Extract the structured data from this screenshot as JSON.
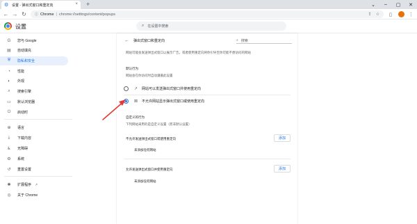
{
  "tab": {
    "title": "设置 - 弹出式窗口和重定向",
    "close": "×",
    "new_tab": "+"
  },
  "window_controls": [
    "⌄",
    "–",
    "▢",
    "✕"
  ],
  "toolbar": {
    "back": "←",
    "forward": "→",
    "reload": "↻",
    "omnibox_site": "Chrome",
    "omnibox_separator": "|",
    "omnibox_url": "chrome://settings/content/popups",
    "omnibox_icons": [
      "⇪",
      "☆"
    ]
  },
  "header": {
    "title": "设置",
    "search_placeholder": "在设置中搜索"
  },
  "sidebar": {
    "items": [
      {
        "label": "您与 Google",
        "icon": "G"
      },
      {
        "label": "自动填充",
        "icon": "▤"
      },
      {
        "label": "隐私和安全",
        "icon": "⛨",
        "active": true
      },
      {
        "label": "性能",
        "icon": "◔"
      },
      {
        "label": "外观",
        "icon": "◐"
      },
      {
        "label": "搜索引擎",
        "icon": "⌕"
      },
      {
        "label": "默认浏览器",
        "icon": "▭"
      },
      {
        "label": "启动时",
        "icon": "⏻"
      },
      {
        "label": "语言",
        "icon": "⊕"
      },
      {
        "label": "下载内容",
        "icon": "⤓"
      },
      {
        "label": "无障碍",
        "icon": "♿"
      },
      {
        "label": "系统",
        "icon": "⚙"
      },
      {
        "label": "重置设置",
        "icon": "↺"
      },
      {
        "label": "扩展程序",
        "icon": "✱"
      },
      {
        "label": "关于 Chrome",
        "icon": "◎"
      }
    ],
    "external_icon": "↗"
  },
  "card": {
    "back": "←",
    "title": "弹出式窗口和重定向",
    "search_placeholder": "搜索",
    "description": "网站可能会发送弹出式窗口以展示广告，或者使用重定向将你引导至你可能不想访问的网站",
    "default_title": "默认行为",
    "default_sub": "网站会在你访问时自动遵循此设置",
    "options": [
      {
        "label": "网站可以发送弹出式窗口并使用重定向",
        "icon": "↗",
        "checked": false
      },
      {
        "label": "不允许网站显示弹出式窗口或使用重定向",
        "icon": "⊠",
        "checked": true
      }
    ],
    "custom_title": "自定义的行为",
    "custom_sub": "下列网站采用的是自定义设置（而非默认设置）",
    "block_title": "不允许发送弹出式窗口或使用重定向",
    "block_add": "添加",
    "block_empty": "未添加任何网站",
    "allow_title": "允许发送弹出式窗口并使用重定向",
    "allow_add": "添加",
    "allow_empty": "未添加任何网站"
  },
  "colors": {
    "accent": "#1a73e8",
    "annotation": "#e53935"
  }
}
